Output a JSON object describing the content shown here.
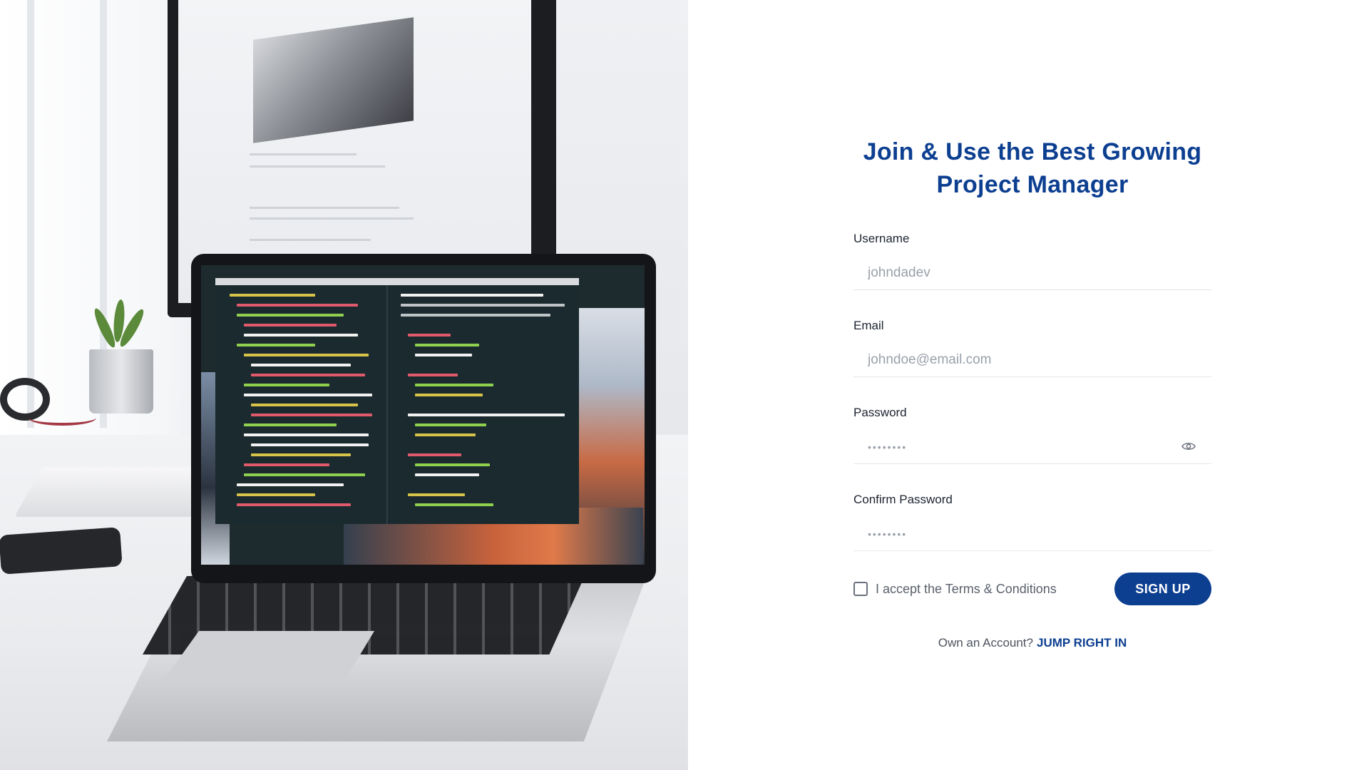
{
  "hero": {
    "image_description": "laptop-and-monitor-desk-photo"
  },
  "form": {
    "title_line1": "Join & Use the Best Growing",
    "title_line2": "Project Manager",
    "username": {
      "label": "Username",
      "placeholder": "johndadev"
    },
    "email": {
      "label": "Email",
      "placeholder": "johndoe@email.com"
    },
    "password": {
      "label": "Password",
      "value": "••••••••",
      "toggle_icon": "eye-icon"
    },
    "confirm_password": {
      "label": "Confirm Password",
      "value": "••••••••"
    },
    "terms_label": "I accept the Terms & Conditions",
    "terms_checked": false,
    "submit_label": "SIGN UP",
    "footer_prompt": "Own an Account?",
    "footer_link": "JUMP RIGHT IN"
  },
  "colors": {
    "brand": "#0d3f91",
    "label": "#1d2330",
    "placeholder": "#9aa0aa",
    "divider": "#e5e7eb"
  }
}
